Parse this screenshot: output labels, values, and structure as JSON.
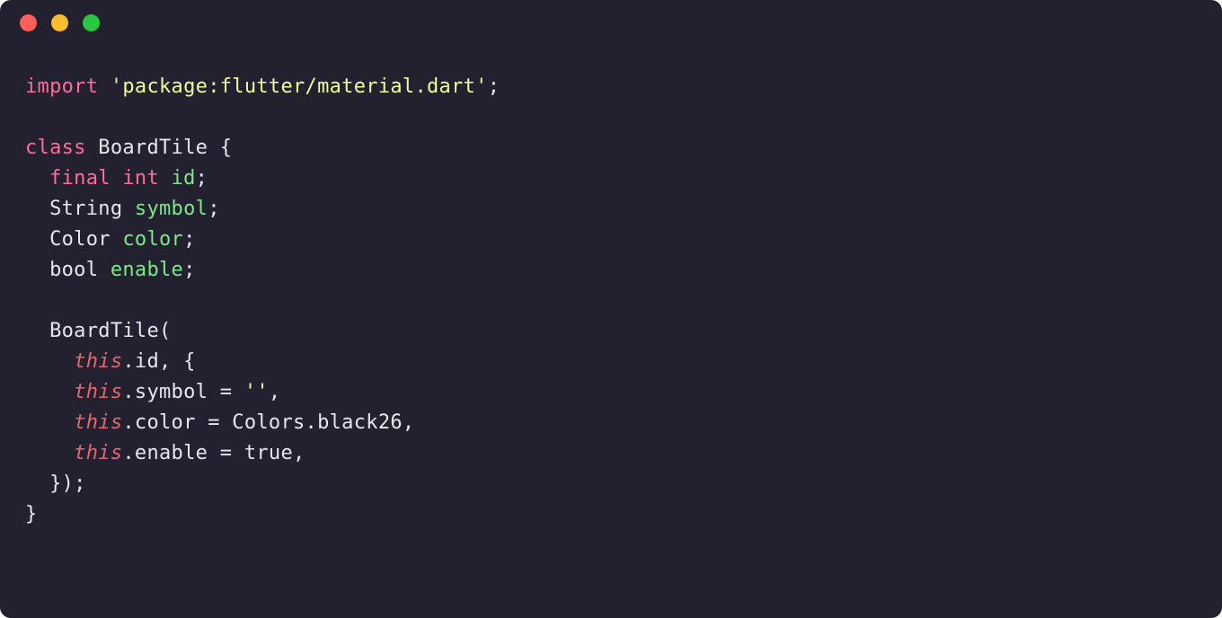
{
  "window": {
    "traffic_lights": [
      "close",
      "minimize",
      "zoom"
    ]
  },
  "code": {
    "language": "dart",
    "tokens": [
      [
        [
          "import ",
          "keyword"
        ],
        [
          "'package:flutter/material.dart'",
          "string"
        ],
        [
          ";",
          "punct"
        ]
      ],
      [
        [
          "",
          "blank"
        ]
      ],
      [
        [
          "class ",
          "keyword"
        ],
        [
          "BoardTile ",
          "type"
        ],
        [
          "{",
          "punct"
        ]
      ],
      [
        [
          "  ",
          "plain"
        ],
        [
          "final ",
          "keyword"
        ],
        [
          "int ",
          "keyword"
        ],
        [
          "id",
          "ident"
        ],
        [
          ";",
          "punct"
        ]
      ],
      [
        [
          "  String ",
          "type"
        ],
        [
          "symbol",
          "ident"
        ],
        [
          ";",
          "punct"
        ]
      ],
      [
        [
          "  Color ",
          "type"
        ],
        [
          "color",
          "ident"
        ],
        [
          ";",
          "punct"
        ]
      ],
      [
        [
          "  bool ",
          "type"
        ],
        [
          "enable",
          "ident"
        ],
        [
          ";",
          "punct"
        ]
      ],
      [
        [
          "",
          "blank"
        ]
      ],
      [
        [
          "  BoardTile(",
          "type"
        ]
      ],
      [
        [
          "    ",
          "plain"
        ],
        [
          "this",
          "this"
        ],
        [
          ".id, {",
          "prop"
        ]
      ],
      [
        [
          "    ",
          "plain"
        ],
        [
          "this",
          "this"
        ],
        [
          ".symbol = ",
          "prop"
        ],
        [
          "''",
          "string"
        ],
        [
          ",",
          "punct"
        ]
      ],
      [
        [
          "    ",
          "plain"
        ],
        [
          "this",
          "this"
        ],
        [
          ".color = Colors.black26,",
          "prop"
        ]
      ],
      [
        [
          "    ",
          "plain"
        ],
        [
          "this",
          "this"
        ],
        [
          ".enable = ",
          "prop"
        ],
        [
          "true",
          "bool"
        ],
        [
          ",",
          "punct"
        ]
      ],
      [
        [
          "  });",
          "punct"
        ]
      ],
      [
        [
          "}",
          "punct"
        ]
      ]
    ]
  }
}
